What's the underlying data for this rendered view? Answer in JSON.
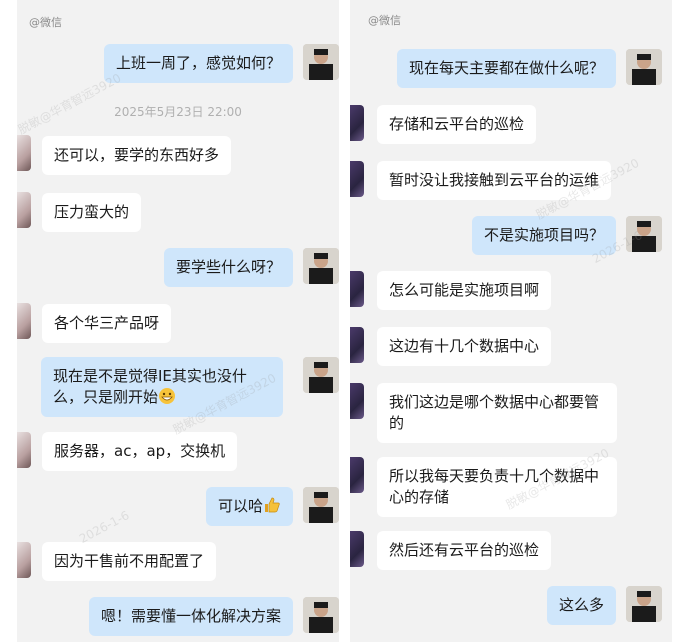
{
  "left": {
    "source": "@微信",
    "timestamp": "2025年5月23日  22:00",
    "messages": [
      {
        "side": "out",
        "text": "上班一周了，感觉如何？"
      },
      {
        "side": "in",
        "text": "还可以，要学的东西好多"
      },
      {
        "side": "in",
        "text": "压力蛮大的"
      },
      {
        "side": "out",
        "text": "要学些什么呀？"
      },
      {
        "side": "in",
        "text": "各个华三产品呀"
      },
      {
        "side": "out",
        "text": "现在是不是觉得IE其实也没什么，只是刚开始"
      },
      {
        "side": "in",
        "text": "服务器，ac，ap，交换机"
      },
      {
        "side": "out",
        "text": "可以哈"
      },
      {
        "side": "in",
        "text": "因为干售前不用配置了"
      },
      {
        "side": "out",
        "text": "嗯！需要懂一体化解决方案"
      }
    ]
  },
  "right": {
    "source": "@微信",
    "messages": [
      {
        "side": "out",
        "text": "现在每天主要都在做什么呢？"
      },
      {
        "side": "in",
        "text": "存储和云平台的巡检"
      },
      {
        "side": "in",
        "text": "暂时没让我接触到云平台的运维"
      },
      {
        "side": "out",
        "text": "不是实施项目吗？"
      },
      {
        "side": "in",
        "text": "怎么可能是实施项目啊"
      },
      {
        "side": "in",
        "text": "这边有十几个数据中心"
      },
      {
        "side": "in",
        "text": "我们这边是哪个数据中心都要管的"
      },
      {
        "side": "in",
        "text": "所以我每天要负责十几个数据中心的存储"
      },
      {
        "side": "in",
        "text": "然后还有云平台的巡检"
      },
      {
        "side": "out",
        "text": "这么多"
      }
    ]
  },
  "watermark": {
    "line1": "脱敏@华育智远3920",
    "line2": "2026-1-6"
  },
  "colors": {
    "out_bubble": "#cfe6fb",
    "in_bubble": "#ffffff",
    "background": "#f2f2f2"
  }
}
